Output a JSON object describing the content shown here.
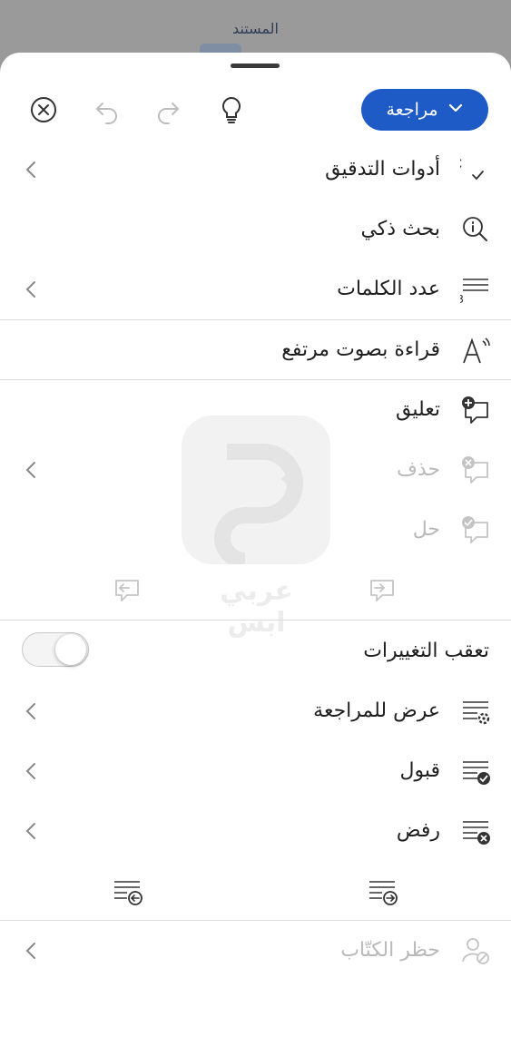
{
  "header": {
    "title": "المستند"
  },
  "toolbar": {
    "ribbon_label": "مراجعة",
    "icons": [
      "close-circle-icon",
      "undo-icon",
      "redo-icon",
      "lightbulb-icon",
      "chevron-down-icon"
    ]
  },
  "menu": {
    "proofing": "أدوات التدقيق",
    "smart_lookup": "بحث ذكي",
    "word_count": "عدد الكلمات",
    "read_aloud": "قراءة بصوت مرتفع",
    "comment": "تعليق",
    "delete": "حذف",
    "resolve": "حل",
    "track_changes": "تعقب التغييرات",
    "display_for_review": "عرض للمراجعة",
    "accept": "قبول",
    "reject": "رفض",
    "block_authors": "حظر الكتّاب"
  },
  "track_changes_state": false,
  "watermark": {
    "text": "عربي ابس"
  },
  "colors": {
    "accent": "#1e5bc6",
    "disabled": "#b9b9b9"
  }
}
